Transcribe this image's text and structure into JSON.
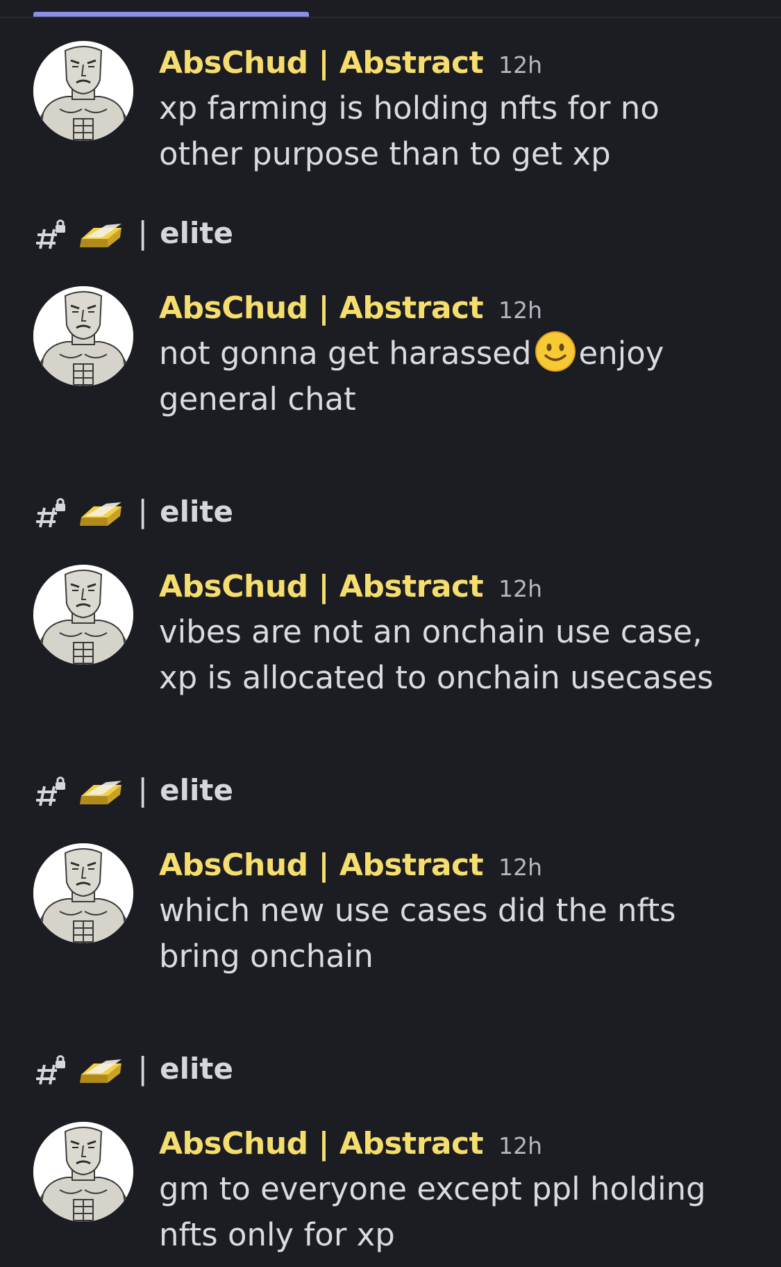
{
  "colors": {
    "background": "#1c1d22",
    "author_name": "#f5dd6e",
    "timestamp": "#b5b8c0",
    "message_text": "#d9dbe1",
    "indicator": "#8a90e6"
  },
  "icons": {
    "channel": "hash-lock-icon",
    "channel_emoji": "gold-bar-icon",
    "inline_emoji": "slightly-smiling-face-emoji"
  },
  "feed": [
    {
      "author": "AbsChud | Abstract",
      "time": "12h",
      "text": "xp farming is holding nfts for no other purpose than to get xp"
    },
    {
      "channel": {
        "separator": "|",
        "name": "elite"
      },
      "author": "AbsChud | Abstract",
      "time": "12h",
      "text_before": "not gonna get harassed",
      "text_after": "enjoy general chat"
    },
    {
      "channel": {
        "separator": "|",
        "name": "elite"
      },
      "author": "AbsChud | Abstract",
      "time": "12h",
      "text": "vibes are not an onchain use case, xp is allocated to onchain usecases"
    },
    {
      "channel": {
        "separator": "|",
        "name": "elite"
      },
      "author": "AbsChud | Abstract",
      "time": "12h",
      "text": "which new use cases did the nfts bring onchain"
    },
    {
      "channel": {
        "separator": "|",
        "name": "elite"
      },
      "author": "AbsChud | Abstract",
      "time": "12h",
      "text": "gm to everyone except ppl holding nfts only for xp"
    }
  ]
}
